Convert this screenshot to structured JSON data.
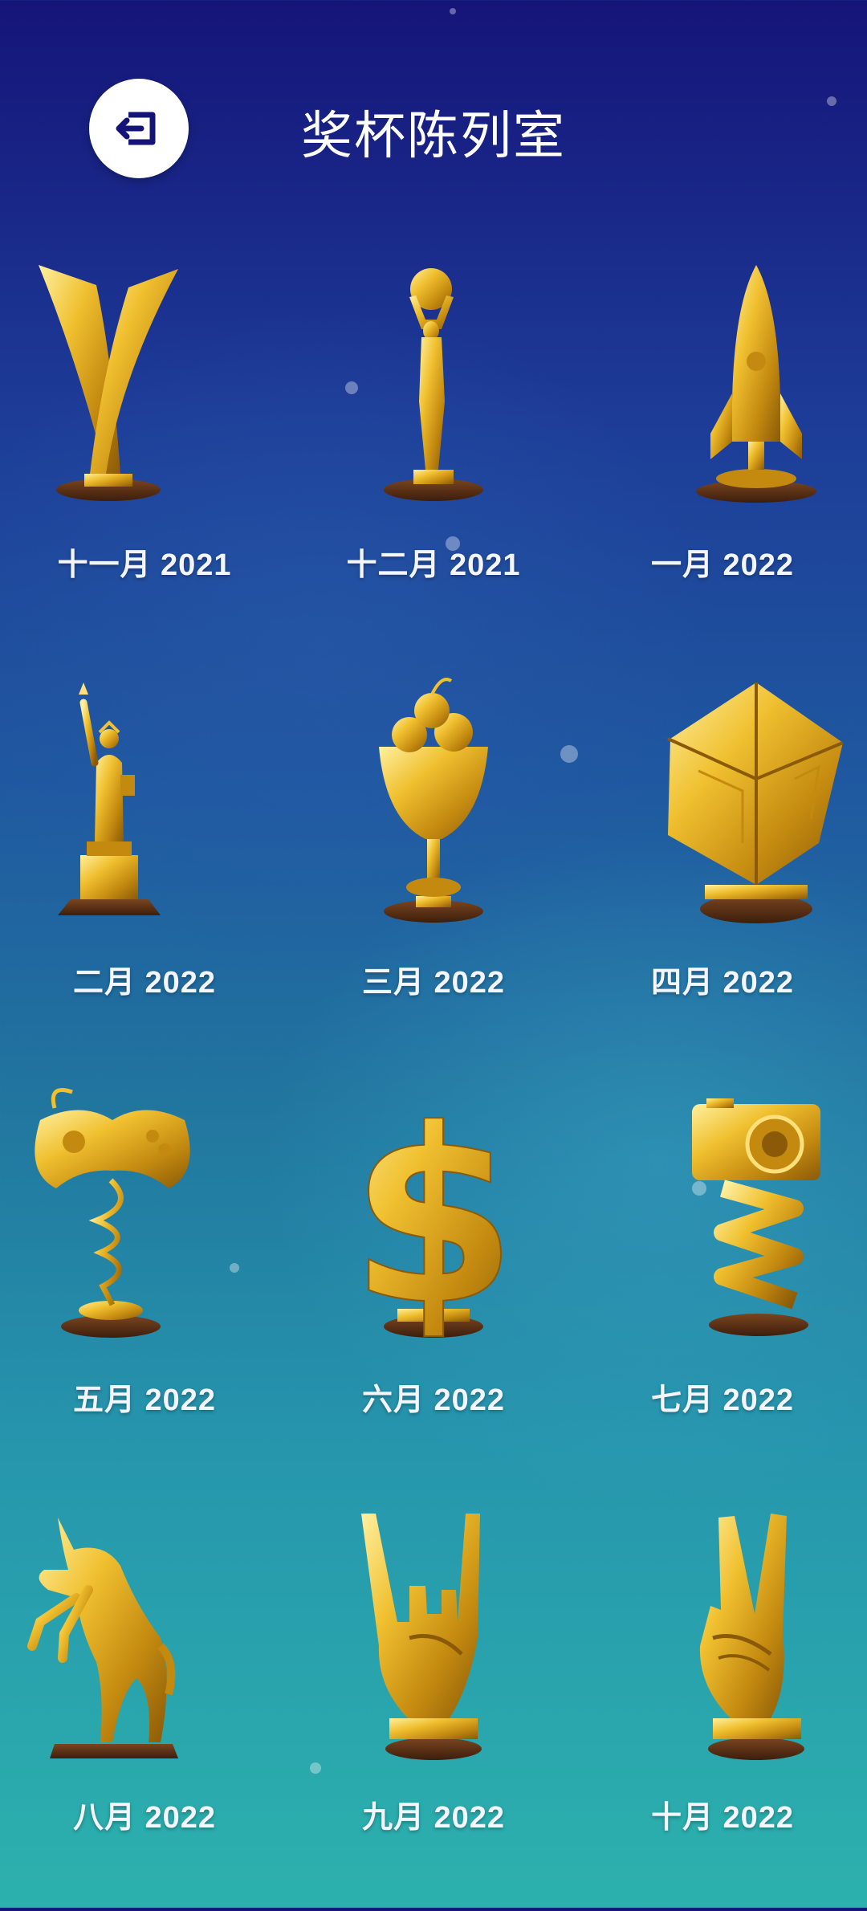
{
  "header": {
    "title": "奖杯陈列室",
    "back_icon": "exit-arrow-icon"
  },
  "colors": {
    "gold": "#e6b12a",
    "gold_light": "#ffe07a",
    "gold_dark": "#8a5a08",
    "base_wood": "#5a3018"
  },
  "trophies": [
    {
      "label": "十一月 2021",
      "icon": "twisted-ribbon-trophy-icon"
    },
    {
      "label": "十二月 2021",
      "icon": "figure-holding-globe-trophy-icon"
    },
    {
      "label": "一月 2022",
      "icon": "rocket-trophy-icon"
    },
    {
      "label": "二月 2022",
      "icon": "statue-of-liberty-trophy-icon"
    },
    {
      "label": "三月 2022",
      "icon": "sundae-cup-trophy-icon"
    },
    {
      "label": "四月 2022",
      "icon": "cube-trophy-icon"
    },
    {
      "label": "五月 2022",
      "icon": "game-controller-trophy-icon"
    },
    {
      "label": "六月 2022",
      "icon": "dollar-sign-trophy-icon"
    },
    {
      "label": "七月 2022",
      "icon": "camera-film-trophy-icon"
    },
    {
      "label": "八月 2022",
      "icon": "unicorn-trophy-icon"
    },
    {
      "label": "九月 2022",
      "icon": "rock-hand-trophy-icon"
    },
    {
      "label": "十月 2022",
      "icon": "peace-hand-trophy-icon"
    }
  ]
}
